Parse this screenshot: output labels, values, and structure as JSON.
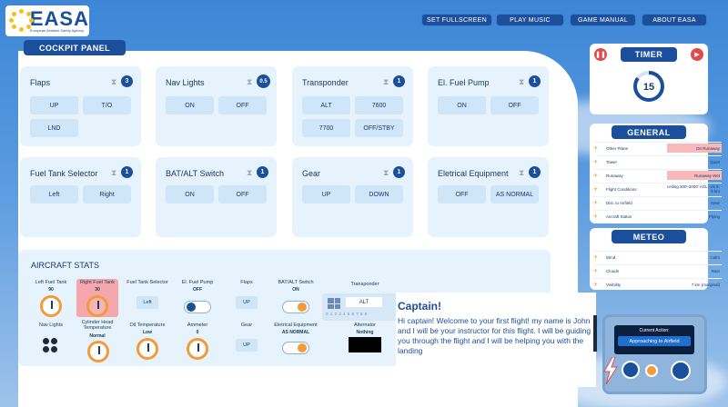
{
  "app": {
    "logo_text": "EASA",
    "logo_sub": "European Aviation Safety Agency"
  },
  "nav": [
    {
      "label": "SET FULLSCREEN"
    },
    {
      "label": "PLAY MUSIC"
    },
    {
      "label": "GAME MANUAL"
    },
    {
      "label": "ABOUT EASA"
    }
  ],
  "cockpit": {
    "title": "COCKPIT PANEL",
    "cards": [
      {
        "title": "Flaps",
        "badge": "3",
        "options": [
          "UP",
          "T/O",
          "LND"
        ]
      },
      {
        "title": "Nav Lights",
        "badge": "0.5",
        "options": [
          "ON",
          "OFF"
        ]
      },
      {
        "title": "Transponder",
        "badge": "1",
        "options": [
          "ALT",
          "7600",
          "7700",
          "OFF/STBY"
        ]
      },
      {
        "title": "El. Fuel Pump",
        "badge": "1",
        "options": [
          "ON",
          "OFF"
        ]
      },
      {
        "title": "Fuel Tank Selector",
        "badge": "1",
        "options": [
          "Left",
          "Right"
        ]
      },
      {
        "title": "BAT/ALT Switch",
        "badge": "1",
        "options": [
          "ON",
          "OFF"
        ]
      },
      {
        "title": "Gear",
        "badge": "1",
        "options": [
          "UP",
          "DOWN"
        ]
      },
      {
        "title": "Eletrical Equipment",
        "badge": "1",
        "options": [
          "OFF",
          "AS NORMAL"
        ]
      }
    ]
  },
  "stats": {
    "title": "AIRCRAFT STATS",
    "left_fuel": {
      "label": "Left Fuel Tank",
      "value": "90"
    },
    "right_fuel": {
      "label": "Right Fuel Tank",
      "value": "30"
    },
    "fuel_selector": {
      "label": "Fuel Tank Selector",
      "value": "Left"
    },
    "fuel_pump": {
      "label": "El. Fuel Pump",
      "value": "OFF"
    },
    "flaps": {
      "label": "Flaps",
      "value": "UP"
    },
    "bat_alt": {
      "label": "BAT/ALT Switch",
      "value": "ON"
    },
    "transponder": {
      "label": "Transponder",
      "value": "ALT",
      "scale": "0 1 2 3 4 5 6 7 8 9"
    },
    "nav_lights": {
      "label": "Nav Lights"
    },
    "cyl_temp": {
      "label": "Cylinder Head Temperature",
      "value": "Normal"
    },
    "oil_temp": {
      "label": "Oil Temperature",
      "value": "Low"
    },
    "ammeter": {
      "label": "Ammeter",
      "value": "0"
    },
    "gear": {
      "label": "Gear",
      "value": "UP"
    },
    "electrical": {
      "label": "Eletrical Equipment",
      "value": "AS NORMAL"
    },
    "alternator": {
      "label": "Alternator",
      "value": "Nothing"
    }
  },
  "timer": {
    "title": "TIMER",
    "value": "15",
    "progress": 0.85
  },
  "general": {
    "title": "GENERAL",
    "rows": [
      {
        "key": "Other Plane",
        "value": "On Runaway",
        "highlight": true
      },
      {
        "key": "Tower",
        "value": "Quiet",
        "highlight": false
      },
      {
        "key": "Runaway",
        "value": "Runaway Wet",
        "highlight": true
      },
      {
        "key": "Flight Conditions",
        "value": "ceiling 300'-3000' AGL; vis 5-8 km",
        "highlight": false
      },
      {
        "key": "Dist. to Airfield",
        "value": "Near",
        "highlight": false
      },
      {
        "key": "Aircraft Status",
        "value": "Flying",
        "highlight": false
      }
    ]
  },
  "meteo": {
    "title": "METEO",
    "rows": [
      {
        "key": "Wind",
        "value": "Calm"
      },
      {
        "key": "Clouds",
        "value": "Rain"
      },
      {
        "key": "Visibility",
        "value": "7 km (marginal)"
      }
    ]
  },
  "dialog": {
    "title": "Captain!",
    "text": "Hi captain! Welcome to your first flight! my name is John and I will be your instructor for this flight. I will be guiding you through the flight and I will be helping you with the landing"
  },
  "action": {
    "label": "Current Action:",
    "value": "Approaching to Airfield"
  },
  "colors": {
    "primary": "#1b4f9c",
    "card_bg": "#e6f2fc",
    "accent": "#f39a3a",
    "highlight": "#f7b9b9"
  }
}
